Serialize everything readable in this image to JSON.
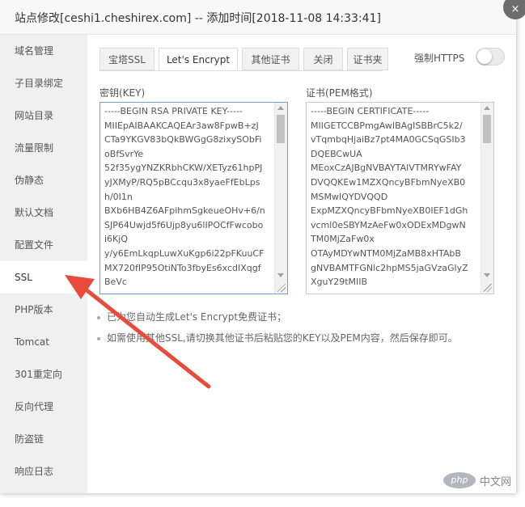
{
  "dialog": {
    "title": "站点修改[ceshi1.cheshirex.com] -- 添加时间[2018-11-08 14:33:41]",
    "close_label": "×"
  },
  "sidebar": {
    "items": [
      {
        "label": "域名管理"
      },
      {
        "label": "子目录绑定"
      },
      {
        "label": "网站目录"
      },
      {
        "label": "流量限制"
      },
      {
        "label": "伪静态"
      },
      {
        "label": "默认文档"
      },
      {
        "label": "配置文件"
      },
      {
        "label": "SSL",
        "active": true
      },
      {
        "label": "PHP版本"
      },
      {
        "label": "Tomcat"
      },
      {
        "label": "301重定向"
      },
      {
        "label": "反向代理"
      },
      {
        "label": "防盗链"
      },
      {
        "label": "响应日志"
      }
    ]
  },
  "ssl": {
    "tabs": [
      {
        "label": "宝塔SSL"
      },
      {
        "label": "Let's Encrypt",
        "active": true
      },
      {
        "label": "其他证书"
      },
      {
        "label": "关闭"
      },
      {
        "label": "证书夹"
      }
    ],
    "force_https_label": "强制HTTPS",
    "force_https_enabled": false,
    "key_label": "密钥(KEY)",
    "key_value": "-----BEGIN RSA PRIVATE KEY-----\nMIIEpAIBAAKCAQEAr3aw8FpwB+zJ\nCTa9YKGV83bQkBWGgG8zixySObFi\noBfSvrYe\n52f35ygYNZKRbhCKW/XETyz61hpPJ\nyJXMyP/RQ5pBCcqu3x8yaeFfEbLps\nh/0I1n\nBXb6HB4Z6AFpihmSgkeueOHv+6/n\nSJP64Uwjd5f6Ujp8yu6lIPOCfFwcobo\ni6KjQ\ny/y6EmLkqpLuwXuKgp6i22pFKuuCF\nMX720fIP95OtiNTo3fbyEs6xcdIXqgf\nBeVc",
    "cert_label": "证书(PEM格式)",
    "cert_value": "-----BEGIN CERTIFICATE-----\nMIIGETCCBPmgAwIBAgISBBrC5k2/\nvTqmbqHjaiBz7pt4MA0GCSqGSIb3\nDQEBCwUA\nMEoxCzAJBgNVBAYTAlVTMRYwFAY\nDVQQKEw1MZXQncyBFbmNyeXB0\nMSMwIQYDVQQD\nExpMZXQncyBFbmNyeXB0IEF1dGh\nvcml0eSBYMzAeFw0xODExMDgwN\nTM0MjZaFw0x\nOTAyMDYwNTM0MjZaMB8xHTAbB\ngNVBAMTFGNlc2hpMS5jaGVzaGlyZ\nXguY29tMIIB",
    "tips": [
      "已为您自动生成Let's Encrypt免费证书；",
      "如需使用其他SSL,请切换其他证书后粘贴您的KEY以及PEM内容，然后保存即可。"
    ]
  },
  "annotation": {
    "color": "#e84a3c"
  },
  "watermark": {
    "logo": "php",
    "text": "中文网"
  }
}
